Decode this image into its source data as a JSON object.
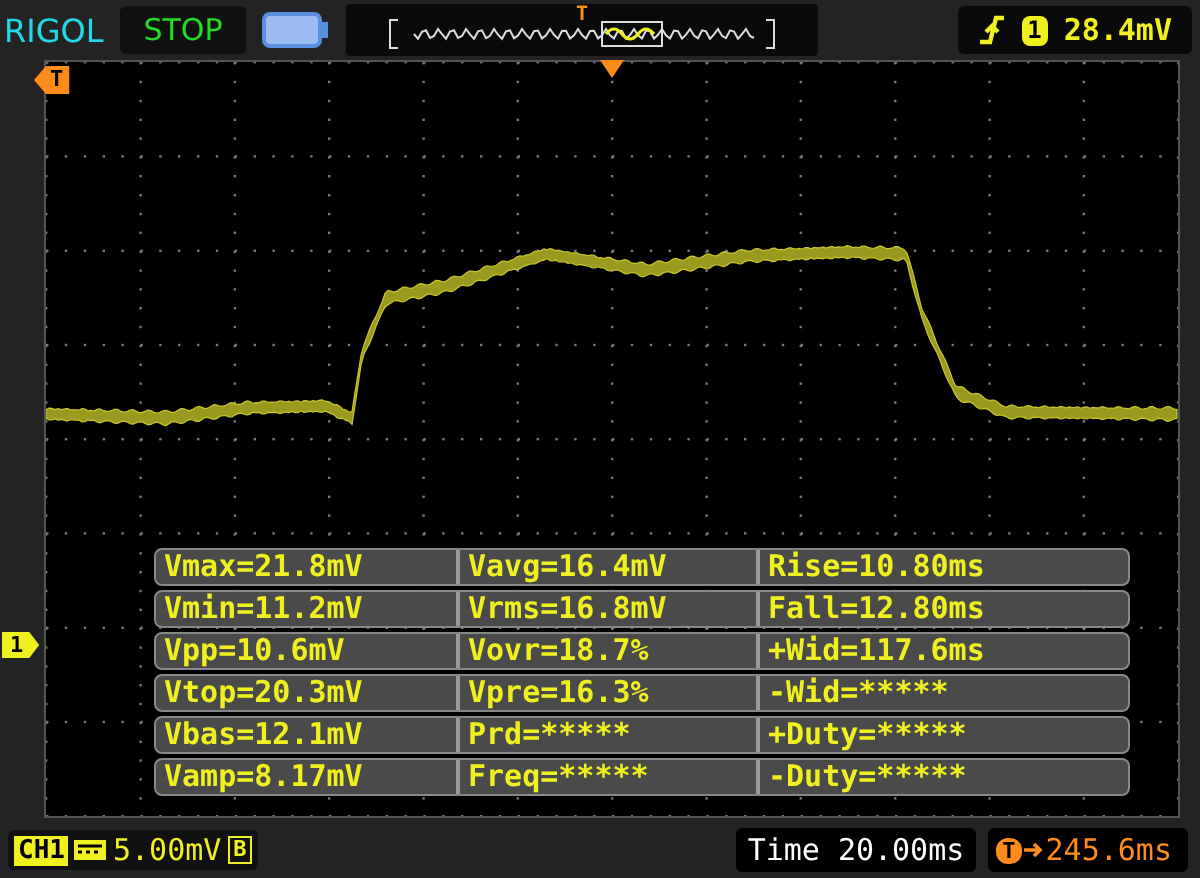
{
  "header": {
    "brand": "RIGOL",
    "run_state": "STOP",
    "memory_bar": {
      "trigger_label": "T"
    },
    "trigger": {
      "source": "1",
      "level": "28.4mV"
    }
  },
  "screen": {
    "trigger_level_marker": "T",
    "channel_marker": "1",
    "measurements": [
      [
        "Vmax=21.8mV",
        "Vavg=16.4mV",
        "Rise=10.80ms"
      ],
      [
        "Vmin=11.2mV",
        "Vrms=16.8mV",
        "Fall=12.80ms"
      ],
      [
        "Vpp=10.6mV",
        "Vovr=18.7%",
        "+Wid=117.6ms"
      ],
      [
        "Vtop=20.3mV",
        "Vpre=16.3%",
        "-Wid=*****"
      ],
      [
        "Vbas=12.1mV",
        "Prd=*****",
        "+Duty=*****"
      ],
      [
        "Vamp=8.17mV",
        "Freq=*****",
        "-Duty=*****"
      ]
    ]
  },
  "footer": {
    "channel": "CH1",
    "scale": "5.00mV",
    "bandwidth_limit": "B",
    "timebase_label": "Time",
    "timebase": "20.00ms",
    "offset_marker": "T",
    "offset": "245.6ms"
  }
}
